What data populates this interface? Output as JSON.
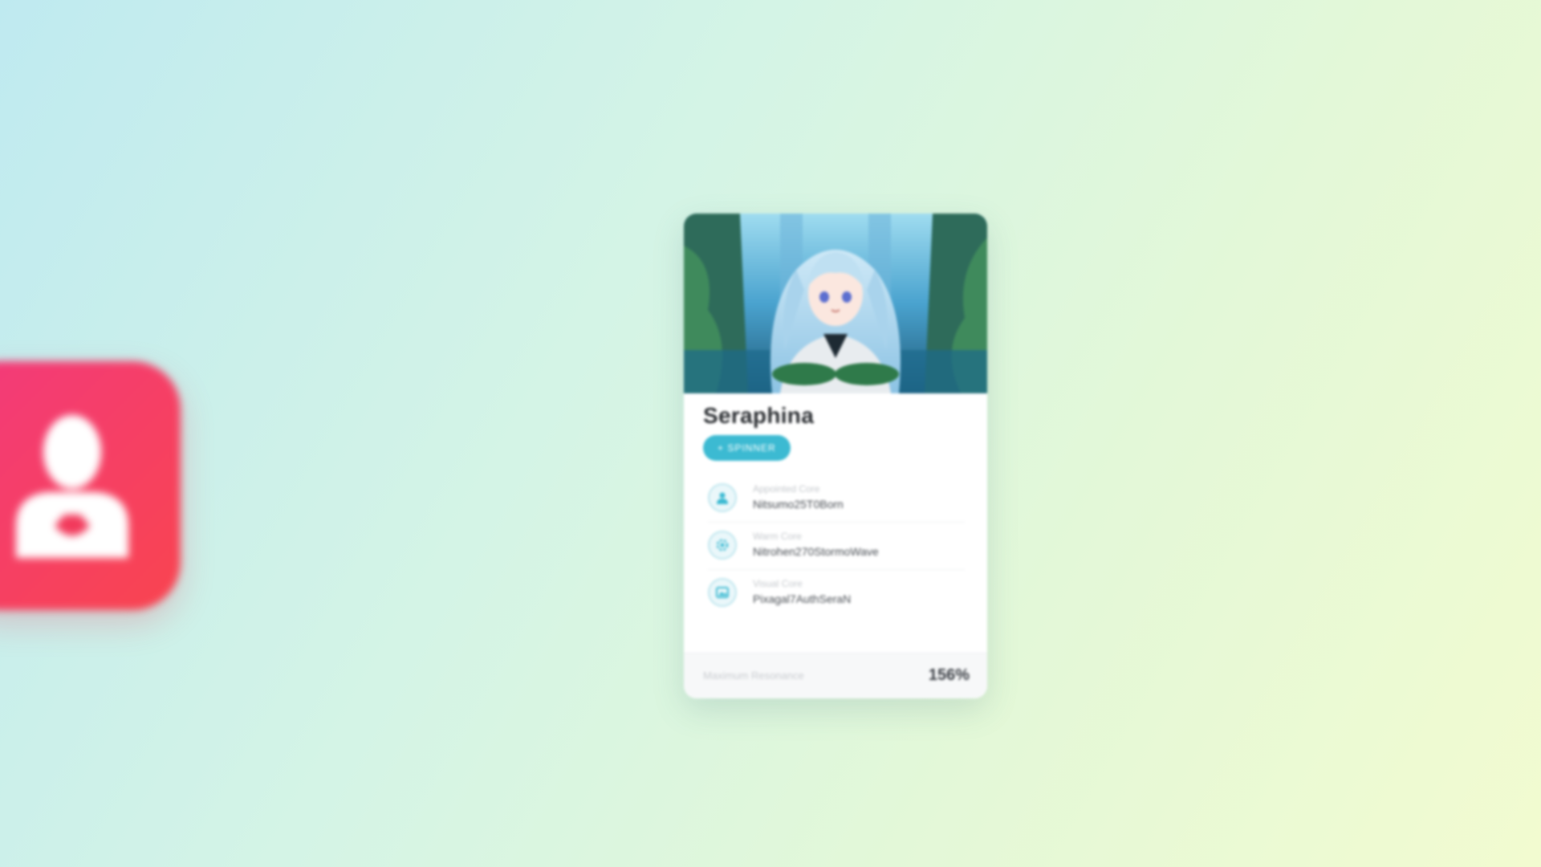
{
  "app_icon": {
    "icon": "user-icon",
    "color": "#f23a7c"
  },
  "card": {
    "name": "Seraphina",
    "role_badge": "+ SPINNER",
    "image": {
      "icon": "character-portrait"
    },
    "info": [
      {
        "icon": "user-icon",
        "label": "Appointed Core",
        "value": "Nitsumo25T0Born"
      },
      {
        "icon": "gear-icon",
        "label": "Warm Core",
        "value": "Nitrohen270StormoWave"
      },
      {
        "icon": "image-icon",
        "label": "Visual Core",
        "value": "Pixagal7AuthSeraN"
      }
    ],
    "footer": {
      "label": "Maximum Resonance",
      "value": "156%"
    },
    "accent_color": "#3cbad2"
  }
}
